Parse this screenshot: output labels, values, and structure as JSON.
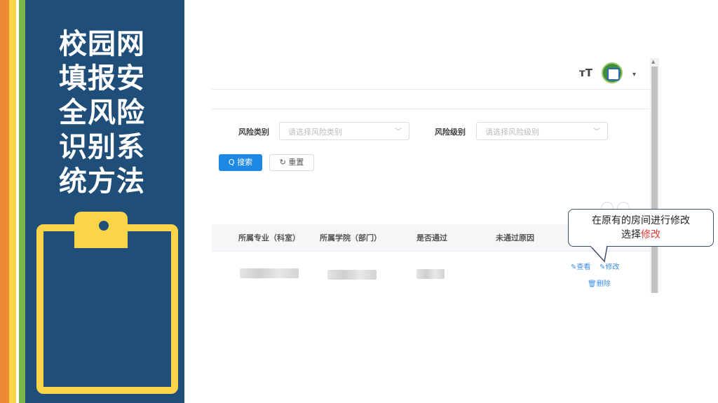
{
  "slide": {
    "title": "校园网填报安全风险识别系统方法",
    "colors": {
      "panel": "#1f4e79",
      "accent_yellow": "#fbd44a",
      "orange": "#ee8a34",
      "green": "#7ab648"
    }
  },
  "app": {
    "header": {
      "font_size_icon": "тT",
      "caret": "▾"
    },
    "filters": {
      "category_label": "风险类别",
      "category_placeholder": "请选择风险类别",
      "level_label": "风险级别",
      "level_placeholder": "请选择风险级别"
    },
    "buttons": {
      "search": "Q 搜索",
      "reset": "↻ 重置"
    },
    "table": {
      "headers": [
        "所属专业（科室）",
        "所属学院（部门）",
        "是否通过",
        "未通过原因"
      ],
      "actions": {
        "view": "查看",
        "edit": "修改",
        "delete": "删除"
      }
    }
  },
  "callout": {
    "line1": "在原有的房间进行修改",
    "line2_prefix": "选择",
    "line2_highlight": "修改"
  }
}
